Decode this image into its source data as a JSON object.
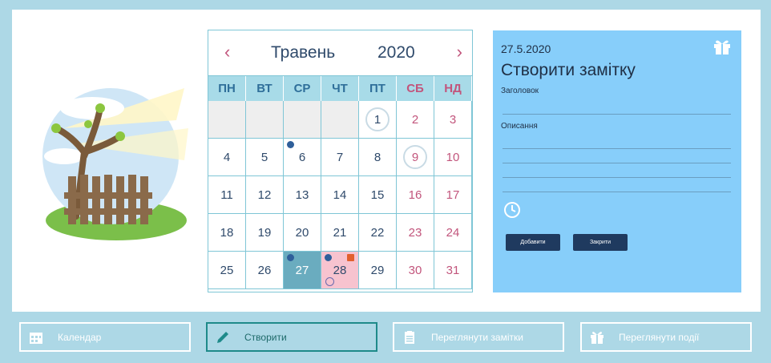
{
  "calendar": {
    "prev": "‹",
    "next": "›",
    "month": "Травень",
    "year": "2020",
    "weekdays": [
      "ПН",
      "ВТ",
      "СР",
      "ЧТ",
      "ПТ",
      "СБ",
      "НД"
    ],
    "weeks": [
      [
        "",
        "",
        "",
        "",
        "1",
        "2",
        "3"
      ],
      [
        "4",
        "5",
        "6",
        "7",
        "8",
        "9",
        "10"
      ],
      [
        "11",
        "12",
        "13",
        "14",
        "15",
        "16",
        "17"
      ],
      [
        "18",
        "19",
        "20",
        "21",
        "22",
        "23",
        "24"
      ],
      [
        "25",
        "26",
        "27",
        "28",
        "29",
        "30",
        "31"
      ]
    ],
    "selected_day": "27",
    "highlight_day": "28",
    "event_icons": {
      "6": [
        "globe-icon"
      ],
      "27": [
        "globe-icon"
      ],
      "28": [
        "globe-icon",
        "gift-icon",
        "clock-icon"
      ]
    },
    "decorated_days": [
      "1",
      "9"
    ]
  },
  "note": {
    "date": "27.5.2020",
    "heading": "Створити замітку",
    "title_label": "Заголовок",
    "description_label": "Описання",
    "add_button": "Добавити",
    "close_button": "Закрити"
  },
  "tabs": [
    {
      "label": "Календар",
      "icon": "calendar-icon"
    },
    {
      "label": "Створити",
      "icon": "pencil-icon"
    },
    {
      "label": "Переглянути замітки",
      "icon": "clipboard-icon"
    },
    {
      "label": "Переглянути події",
      "icon": "gift-icon"
    }
  ],
  "colors": {
    "background": "#add8e6",
    "accent": "#87cefa",
    "weekend": "#c2557c",
    "selected": "#6aacbf",
    "highlight": "#f7c3cf",
    "button": "#1f3a5f"
  }
}
